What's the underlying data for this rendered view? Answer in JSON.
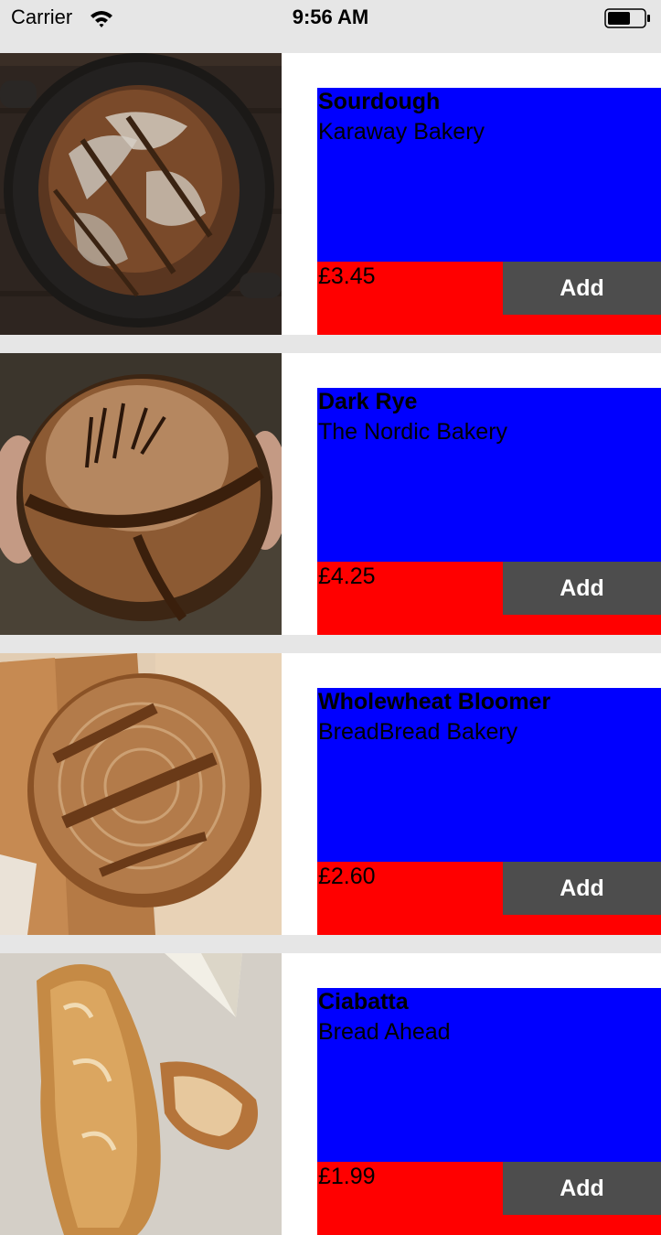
{
  "status_bar": {
    "carrier": "Carrier",
    "time": "9:56 AM",
    "wifi_icon": "wifi-icon",
    "battery_icon": "battery-icon"
  },
  "colors": {
    "info_top": "#0000ff",
    "info_bottom": "#ff0000",
    "add_button": "#4d4d4d",
    "separator": "#e6e6e6"
  },
  "products": [
    {
      "name": "Sourdough",
      "bakery": "Karaway Bakery",
      "price": "£3.45",
      "add_label": "Add",
      "image": "sourdough-photo"
    },
    {
      "name": "Dark Rye",
      "bakery": "The Nordic Bakery",
      "price": "£4.25",
      "add_label": "Add",
      "image": "dark-rye-photo"
    },
    {
      "name": "Wholewheat Bloomer",
      "bakery": "BreadBread Bakery",
      "price": "£2.60",
      "add_label": "Add",
      "image": "wholewheat-bloomer-photo"
    },
    {
      "name": "Ciabatta",
      "bakery": "Bread Ahead",
      "price": "£1.99",
      "add_label": "Add",
      "image": "ciabatta-photo"
    }
  ]
}
